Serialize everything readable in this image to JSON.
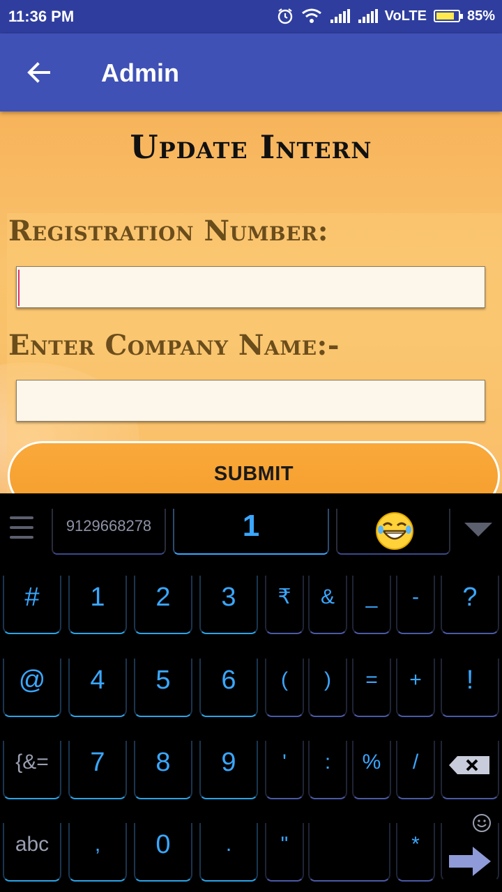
{
  "status_bar": {
    "time": "11:36 PM",
    "network": "VoLTE",
    "battery": "85%",
    "battery_level": 0.85
  },
  "app_bar": {
    "title": "Admin",
    "back_icon": "arrow-back-icon"
  },
  "form": {
    "title": "Update Intern",
    "registration_label": "Registration Number:",
    "registration_value": "",
    "company_label": "Enter Company Name:-",
    "company_value": "",
    "submit_label": "SUBMIT"
  },
  "keyboard": {
    "suggestions": {
      "left": "9129668278",
      "middle": "1",
      "right_icon": "laughing-emoji-icon"
    },
    "rows": [
      [
        "#",
        "1",
        "2",
        "3",
        "₹",
        "&",
        "_",
        "-",
        "?"
      ],
      [
        "@",
        "4",
        "5",
        "6",
        "(",
        ")",
        "=",
        "+",
        "!"
      ],
      [
        "{&=",
        "7",
        "8",
        "9",
        "'",
        ":",
        "%",
        "/",
        "⌫"
      ],
      [
        "abc",
        ",",
        "0",
        ".",
        "\"",
        "",
        "*",
        "➡"
      ]
    ]
  }
}
